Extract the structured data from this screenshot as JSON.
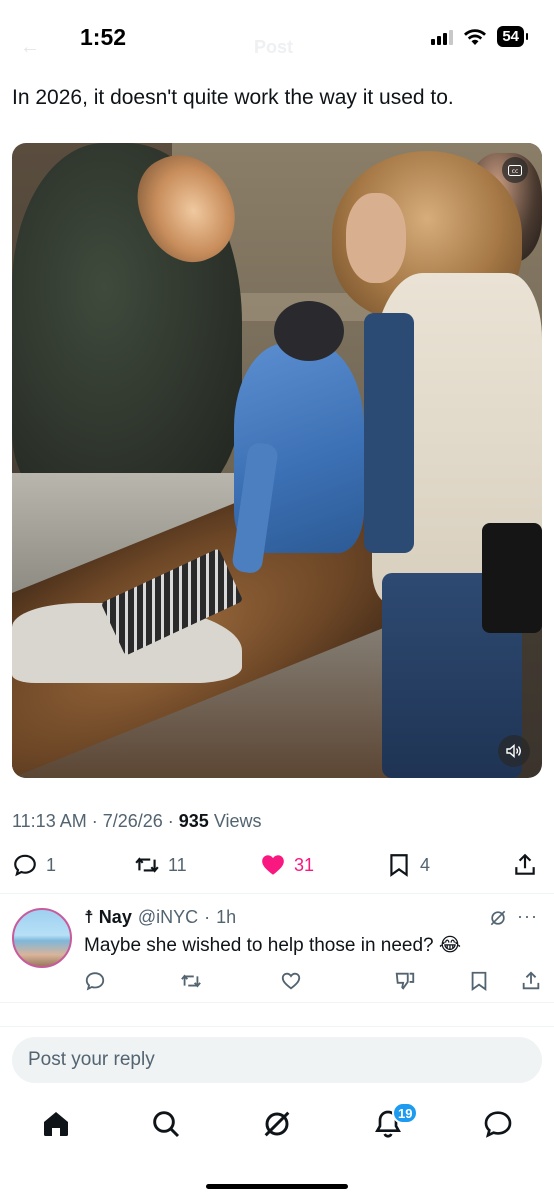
{
  "status_bar": {
    "time": "1:52",
    "battery": "54"
  },
  "header": {
    "title": "Post"
  },
  "post": {
    "text": "In 2026, it doesn't quite work the way it used to.",
    "media_type": "video",
    "time": "11:13 AM",
    "date": "7/26/26",
    "views_count": "935",
    "views_label": "Views"
  },
  "actions": {
    "replies": "1",
    "reposts": "11",
    "likes": "31",
    "bookmarks": "4"
  },
  "reply": {
    "name": "☨ Nay",
    "handle": "@iNYC",
    "age": "1h",
    "text": "Maybe she wished to help those in need? 😂"
  },
  "composer": {
    "placeholder": "Post your reply"
  },
  "tabbar": {
    "notifications_badge": "19"
  },
  "colors": {
    "accent": "#1d9bf0",
    "like": "#f91880",
    "secondary_text": "#536471"
  }
}
